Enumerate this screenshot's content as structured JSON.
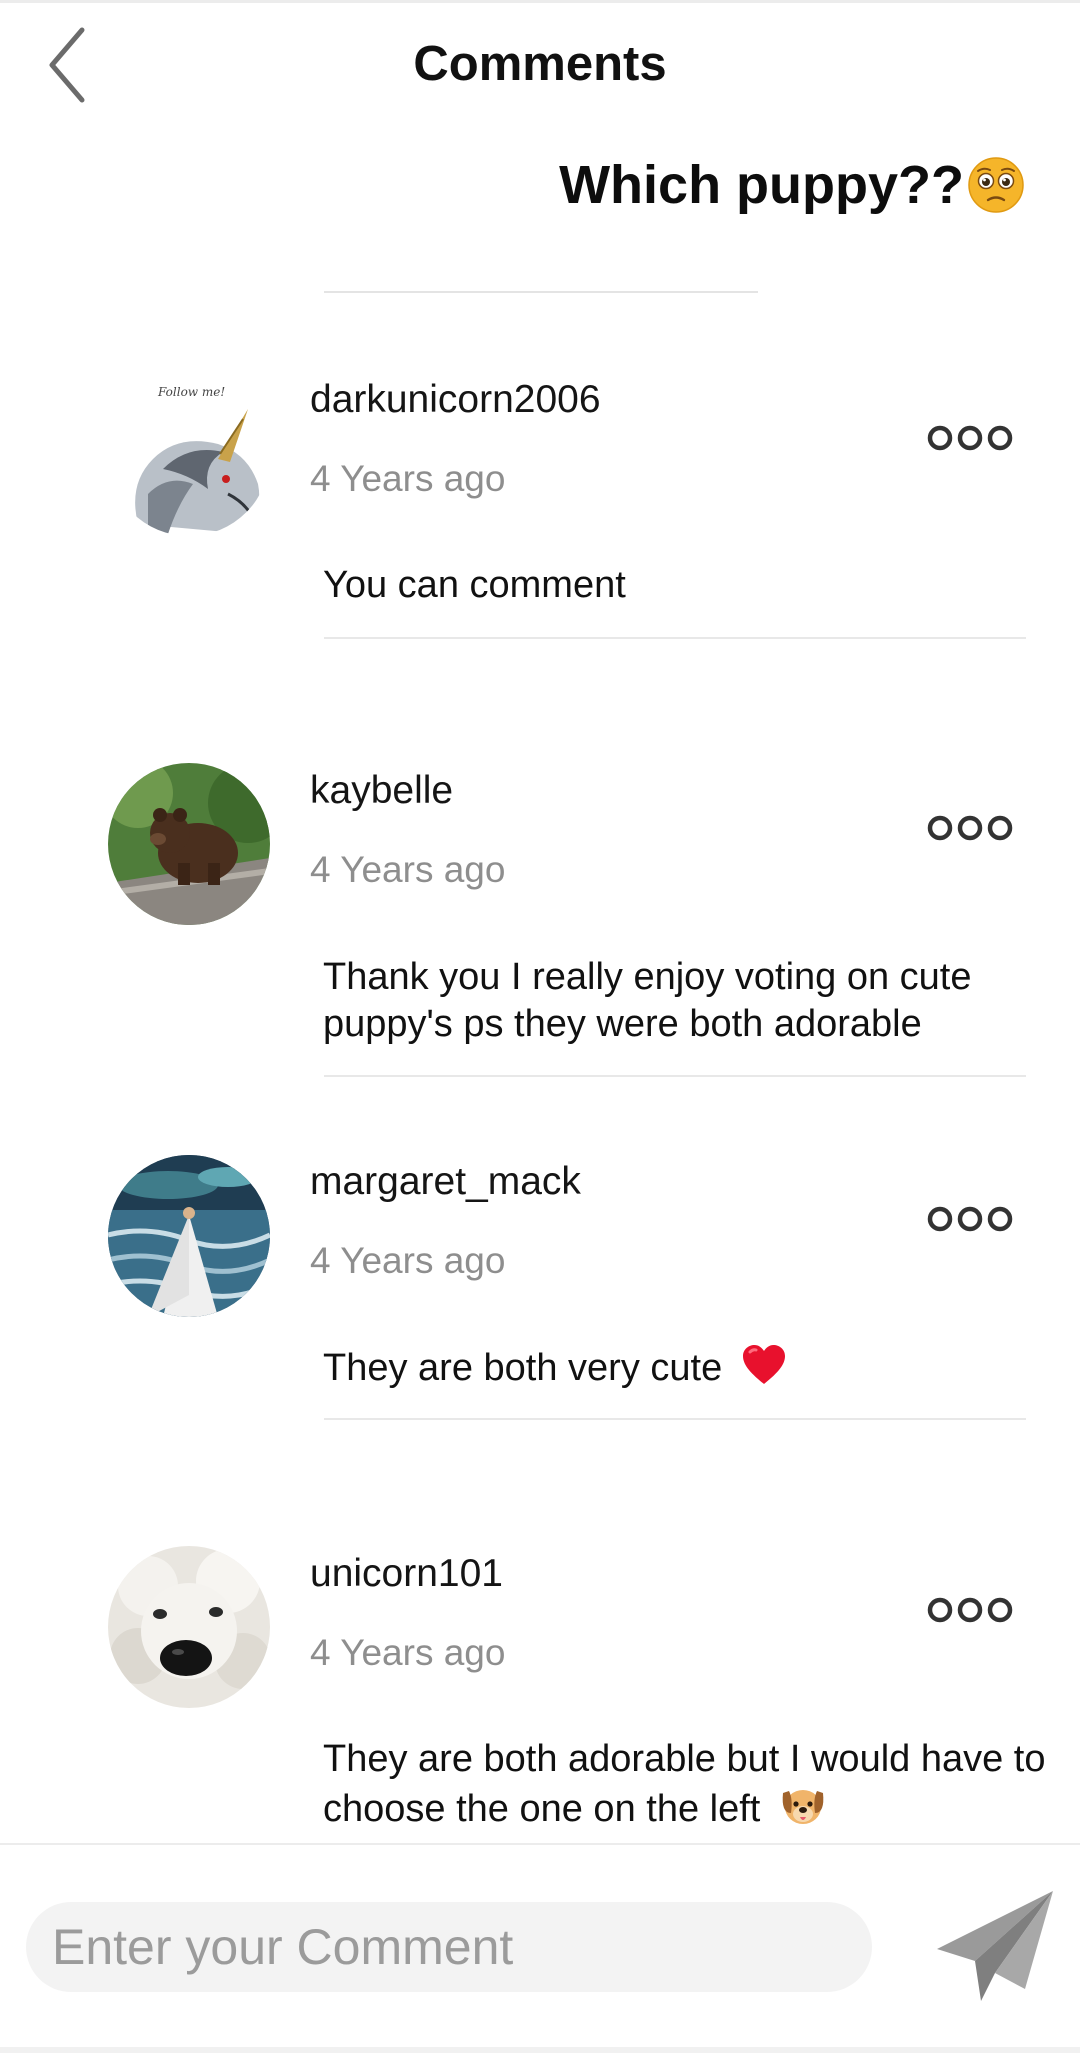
{
  "header": {
    "title": "Comments",
    "back_icon": "chevron-left-icon"
  },
  "post": {
    "title": "Which puppy??",
    "title_emoji": "pleading-face-emoji"
  },
  "comments": [
    {
      "username": "darkunicorn2006",
      "time": "4 Years ago",
      "text": "You can comment",
      "avatar": "unicorn-avatar",
      "avatar_caption": "Follow me!"
    },
    {
      "username": "kaybelle",
      "time": "4 Years ago",
      "text": "Thank you I really enjoy voting on cute puppy's ps they were both adorable",
      "avatar": "bear-cub-avatar"
    },
    {
      "username": "margaret_mack",
      "time": "4 Years ago",
      "text": "They are both very cute",
      "text_emoji": "red-heart-emoji",
      "avatar": "woman-in-white-dress-avatar"
    },
    {
      "username": "unicorn101",
      "time": "4 Years ago",
      "text": "They are both adorable but I would have to choose the one on the left",
      "text_emoji": "dog-face-emoji",
      "avatar": "fluffy-white-dog-avatar"
    }
  ],
  "composer": {
    "placeholder": "Enter your Comment",
    "send_icon": "paper-plane-icon"
  },
  "colors": {
    "text_primary": "#111111",
    "text_secondary": "#8e8e8e",
    "divider": "#e8e8e8",
    "input_bg": "#f3f3f3",
    "send_icon": "#9a9a9a"
  }
}
